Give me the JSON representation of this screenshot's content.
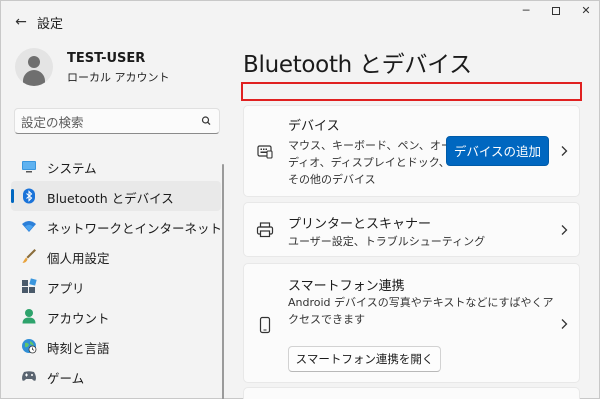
{
  "window": {
    "title": "設定",
    "back_icon": "←",
    "minimize_icon": "─",
    "close_icon": "✕"
  },
  "user": {
    "name": "TEST-USER",
    "account_type": "ローカル アカウント"
  },
  "search": {
    "placeholder": "設定の検索"
  },
  "nav": {
    "items": [
      {
        "label": "システム",
        "icon": "system-monitor-icon",
        "active": false
      },
      {
        "label": "Bluetooth とデバイス",
        "icon": "bluetooth-icon",
        "active": true
      },
      {
        "label": "ネットワークとインターネット",
        "icon": "wifi-icon",
        "active": false
      },
      {
        "label": "個人用設定",
        "icon": "brush-icon",
        "active": false
      },
      {
        "label": "アプリ",
        "icon": "apps-icon",
        "active": false
      },
      {
        "label": "アカウント",
        "icon": "account-icon",
        "active": false
      },
      {
        "label": "時刻と言語",
        "icon": "globe-clock-icon",
        "active": false
      },
      {
        "label": "ゲーム",
        "icon": "game-controller-icon",
        "active": false
      }
    ]
  },
  "main": {
    "page_title": "Bluetooth とデバイス",
    "cards": {
      "devices": {
        "title": "デバイス",
        "desc_lines": [
          "マウス、キーボード、ペン、オー",
          "ディオ、ディスプレイとドック、",
          "その他のデバイス"
        ],
        "button_label": "デバイスの追加"
      },
      "printers": {
        "title": "プリンターとスキャナー",
        "desc": "ユーザー設定、トラブルシューティング"
      },
      "phone": {
        "title": "スマートフォン連携",
        "desc_lines": [
          "Android デバイスの写真やテキストなどにすばやくア",
          "クセスできます"
        ],
        "button_label": "スマートフォン連携を開く"
      }
    }
  },
  "colors": {
    "accent": "#0067c0",
    "highlight_border": "#e02020",
    "window_bg": "#f3f3f3",
    "card_bg": "#fbfbfb"
  }
}
